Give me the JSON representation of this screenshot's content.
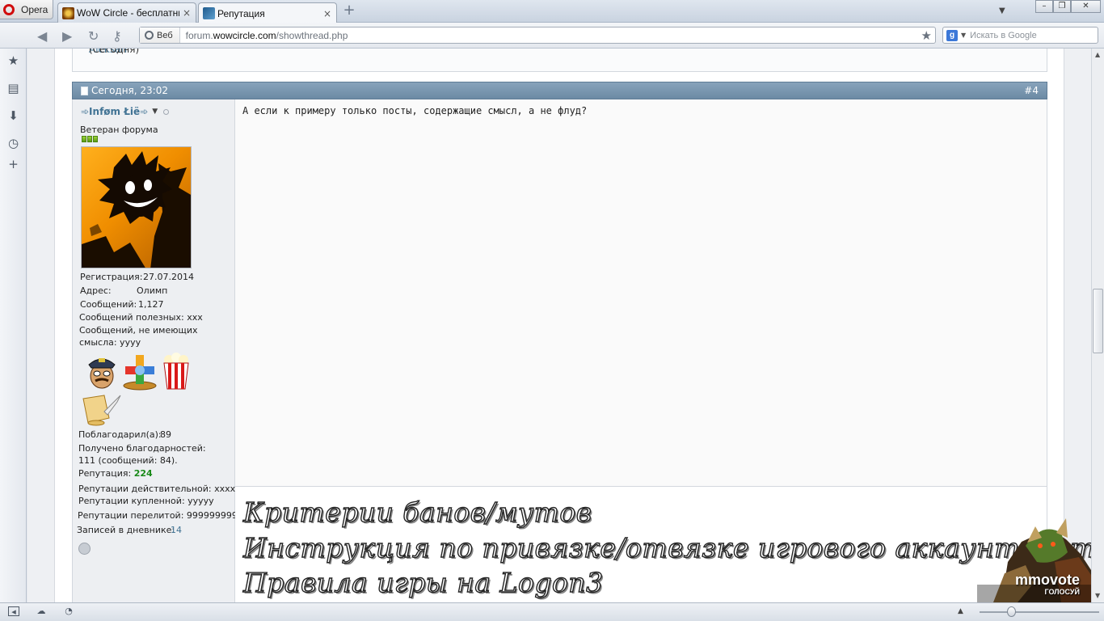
{
  "browser": {
    "opera_label": "Opera",
    "tabs": [
      {
        "label": "WoW Circle - бесплатны...",
        "close": "×"
      },
      {
        "label": "Репутация",
        "close": "×"
      }
    ],
    "new_tab": "+",
    "address": {
      "mode_label": "Веб",
      "url_prefix": "forum.",
      "url_domain": "wowcircle.com",
      "url_path": "/showthread.php"
    },
    "search": {
      "engine_letter": "g",
      "placeholder": "Искать в Google"
    }
  },
  "previous_post": {
    "user_partial": "Aleksan",
    "suffix": " (Сегодня)"
  },
  "post": {
    "date": "Сегодня, 23:02",
    "number": "#4",
    "username": "➾Inføm Łiё➾",
    "user_title": "Ветеран форума",
    "rep_level": 3,
    "info": {
      "reg_label": "Регистрация:",
      "reg_value": "27.07.2014",
      "address_label": "Адрес:",
      "address_value": "Олимп",
      "posts_label": "Сообщений:",
      "posts_value": "1,127",
      "useful_posts": "Сообщений полезных: xxx",
      "meaningless_posts": "Сообщений, не имеющих смысла: yyyy",
      "thanked_label": "Поблагодарил(а):",
      "thanked_value": "89",
      "thanks_received": "Получено благодарностей: 111 (сообщений: 84).",
      "rep_label": "Репутация:",
      "rep_value": "224",
      "rep_real": "Репутации действительной: xxxx",
      "rep_bought": "Репутации купленной: yyyyy",
      "rep_poured": "Репутации перелитой: 999999999",
      "diary_label": "Записей в дневнике:",
      "diary_value": "14"
    },
    "message": "А если к примеру только посты, содержащие смысл, а не флуд?",
    "signature_lines": [
      "Критерии банов/мутов",
      "Инструкция по привязке/отвязке игрового аккаунта к телефону",
      "Правила игры на Logon3"
    ]
  },
  "banner": {
    "brand": "mmovote",
    "caption": "ГОЛОСУЙ"
  },
  "colors": {
    "post_header": "#7893ac",
    "username": "#417394",
    "reputation": "#1a8a1a",
    "opera_red": "#d10d0d"
  }
}
